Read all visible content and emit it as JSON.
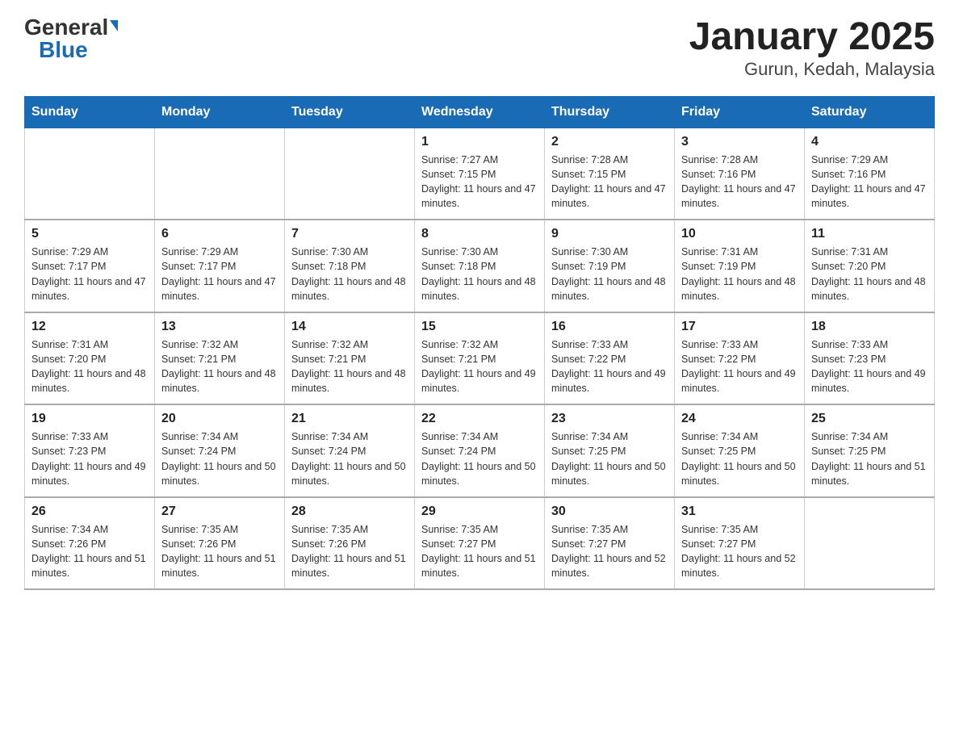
{
  "header": {
    "logo_general": "General",
    "logo_blue": "Blue",
    "title": "January 2025",
    "subtitle": "Gurun, Kedah, Malaysia"
  },
  "days_of_week": [
    "Sunday",
    "Monday",
    "Tuesday",
    "Wednesday",
    "Thursday",
    "Friday",
    "Saturday"
  ],
  "weeks": [
    [
      {
        "day": "",
        "info": ""
      },
      {
        "day": "",
        "info": ""
      },
      {
        "day": "",
        "info": ""
      },
      {
        "day": "1",
        "info": "Sunrise: 7:27 AM\nSunset: 7:15 PM\nDaylight: 11 hours and 47 minutes."
      },
      {
        "day": "2",
        "info": "Sunrise: 7:28 AM\nSunset: 7:15 PM\nDaylight: 11 hours and 47 minutes."
      },
      {
        "day": "3",
        "info": "Sunrise: 7:28 AM\nSunset: 7:16 PM\nDaylight: 11 hours and 47 minutes."
      },
      {
        "day": "4",
        "info": "Sunrise: 7:29 AM\nSunset: 7:16 PM\nDaylight: 11 hours and 47 minutes."
      }
    ],
    [
      {
        "day": "5",
        "info": "Sunrise: 7:29 AM\nSunset: 7:17 PM\nDaylight: 11 hours and 47 minutes."
      },
      {
        "day": "6",
        "info": "Sunrise: 7:29 AM\nSunset: 7:17 PM\nDaylight: 11 hours and 47 minutes."
      },
      {
        "day": "7",
        "info": "Sunrise: 7:30 AM\nSunset: 7:18 PM\nDaylight: 11 hours and 48 minutes."
      },
      {
        "day": "8",
        "info": "Sunrise: 7:30 AM\nSunset: 7:18 PM\nDaylight: 11 hours and 48 minutes."
      },
      {
        "day": "9",
        "info": "Sunrise: 7:30 AM\nSunset: 7:19 PM\nDaylight: 11 hours and 48 minutes."
      },
      {
        "day": "10",
        "info": "Sunrise: 7:31 AM\nSunset: 7:19 PM\nDaylight: 11 hours and 48 minutes."
      },
      {
        "day": "11",
        "info": "Sunrise: 7:31 AM\nSunset: 7:20 PM\nDaylight: 11 hours and 48 minutes."
      }
    ],
    [
      {
        "day": "12",
        "info": "Sunrise: 7:31 AM\nSunset: 7:20 PM\nDaylight: 11 hours and 48 minutes."
      },
      {
        "day": "13",
        "info": "Sunrise: 7:32 AM\nSunset: 7:21 PM\nDaylight: 11 hours and 48 minutes."
      },
      {
        "day": "14",
        "info": "Sunrise: 7:32 AM\nSunset: 7:21 PM\nDaylight: 11 hours and 48 minutes."
      },
      {
        "day": "15",
        "info": "Sunrise: 7:32 AM\nSunset: 7:21 PM\nDaylight: 11 hours and 49 minutes."
      },
      {
        "day": "16",
        "info": "Sunrise: 7:33 AM\nSunset: 7:22 PM\nDaylight: 11 hours and 49 minutes."
      },
      {
        "day": "17",
        "info": "Sunrise: 7:33 AM\nSunset: 7:22 PM\nDaylight: 11 hours and 49 minutes."
      },
      {
        "day": "18",
        "info": "Sunrise: 7:33 AM\nSunset: 7:23 PM\nDaylight: 11 hours and 49 minutes."
      }
    ],
    [
      {
        "day": "19",
        "info": "Sunrise: 7:33 AM\nSunset: 7:23 PM\nDaylight: 11 hours and 49 minutes."
      },
      {
        "day": "20",
        "info": "Sunrise: 7:34 AM\nSunset: 7:24 PM\nDaylight: 11 hours and 50 minutes."
      },
      {
        "day": "21",
        "info": "Sunrise: 7:34 AM\nSunset: 7:24 PM\nDaylight: 11 hours and 50 minutes."
      },
      {
        "day": "22",
        "info": "Sunrise: 7:34 AM\nSunset: 7:24 PM\nDaylight: 11 hours and 50 minutes."
      },
      {
        "day": "23",
        "info": "Sunrise: 7:34 AM\nSunset: 7:25 PM\nDaylight: 11 hours and 50 minutes."
      },
      {
        "day": "24",
        "info": "Sunrise: 7:34 AM\nSunset: 7:25 PM\nDaylight: 11 hours and 50 minutes."
      },
      {
        "day": "25",
        "info": "Sunrise: 7:34 AM\nSunset: 7:25 PM\nDaylight: 11 hours and 51 minutes."
      }
    ],
    [
      {
        "day": "26",
        "info": "Sunrise: 7:34 AM\nSunset: 7:26 PM\nDaylight: 11 hours and 51 minutes."
      },
      {
        "day": "27",
        "info": "Sunrise: 7:35 AM\nSunset: 7:26 PM\nDaylight: 11 hours and 51 minutes."
      },
      {
        "day": "28",
        "info": "Sunrise: 7:35 AM\nSunset: 7:26 PM\nDaylight: 11 hours and 51 minutes."
      },
      {
        "day": "29",
        "info": "Sunrise: 7:35 AM\nSunset: 7:27 PM\nDaylight: 11 hours and 51 minutes."
      },
      {
        "day": "30",
        "info": "Sunrise: 7:35 AM\nSunset: 7:27 PM\nDaylight: 11 hours and 52 minutes."
      },
      {
        "day": "31",
        "info": "Sunrise: 7:35 AM\nSunset: 7:27 PM\nDaylight: 11 hours and 52 minutes."
      },
      {
        "day": "",
        "info": ""
      }
    ]
  ]
}
